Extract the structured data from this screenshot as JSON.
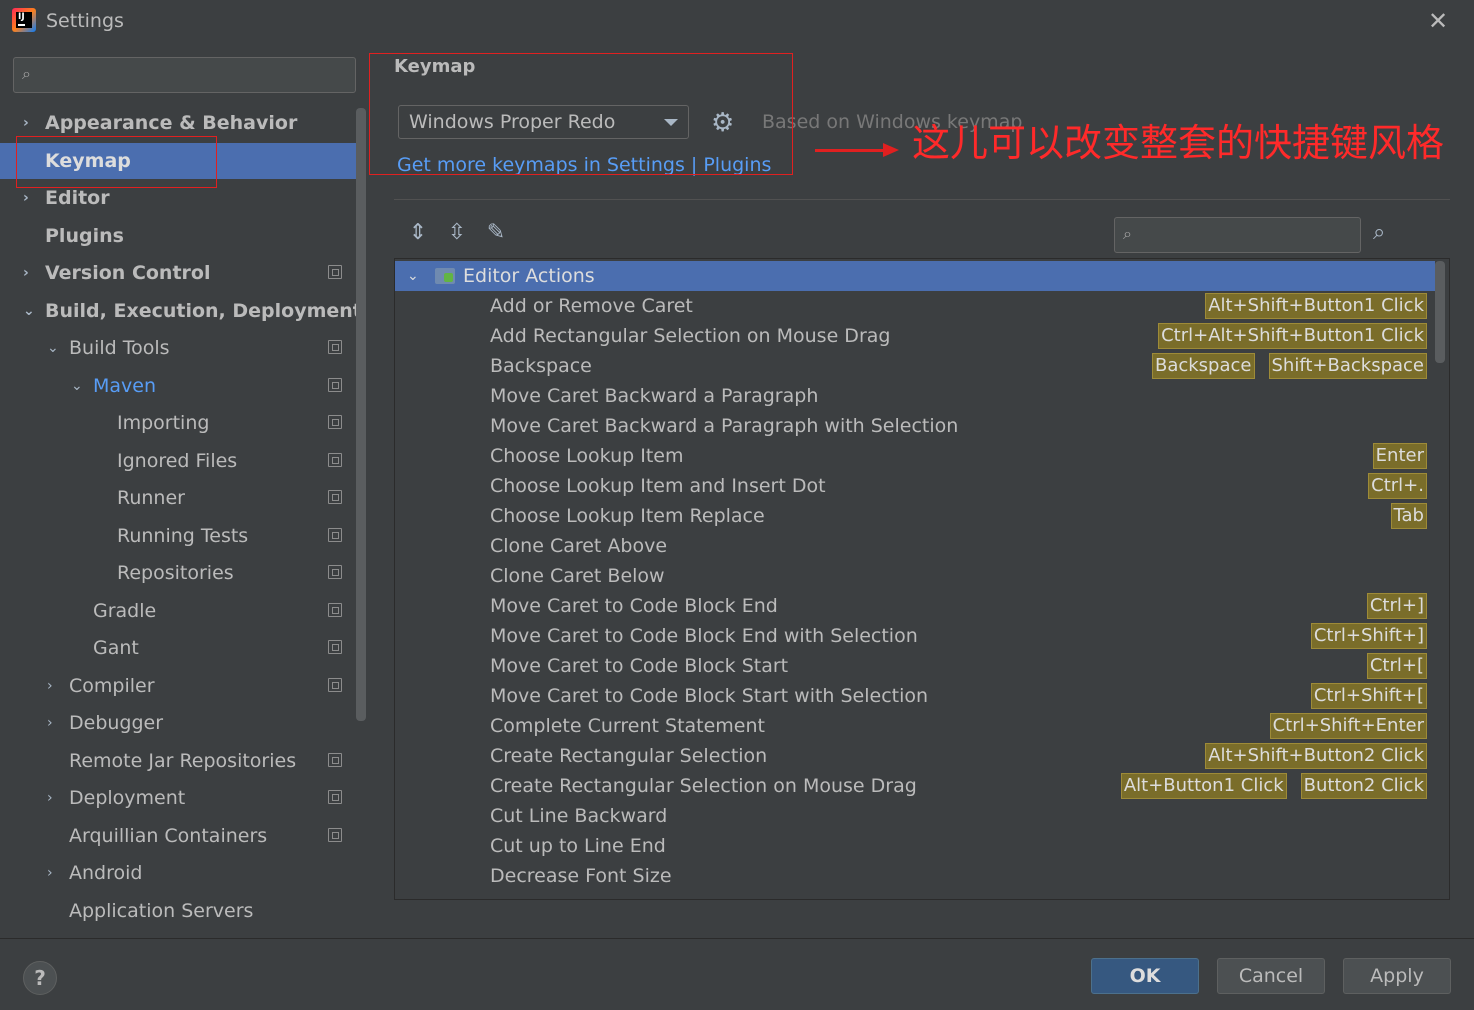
{
  "window": {
    "title": "Settings",
    "app_icon": "intellij-idea-icon",
    "close_glyph": "✕"
  },
  "sidebar": {
    "search_placeholder": "",
    "items": [
      {
        "label": "Appearance & Behavior",
        "arrow": "›"
      },
      {
        "label": "Keymap"
      },
      {
        "label": "Editor",
        "arrow": "›"
      },
      {
        "label": "Plugins"
      },
      {
        "label": "Version Control",
        "arrow": "›"
      },
      {
        "label": "Build, Execution, Deployment",
        "arrow": "⌄"
      },
      {
        "label": "Build Tools",
        "arrow": "⌄"
      },
      {
        "label": "Maven",
        "arrow": "⌄"
      },
      {
        "label": "Importing"
      },
      {
        "label": "Ignored Files"
      },
      {
        "label": "Runner"
      },
      {
        "label": "Running Tests"
      },
      {
        "label": "Repositories"
      },
      {
        "label": "Gradle"
      },
      {
        "label": "Gant"
      },
      {
        "label": "Compiler",
        "arrow": "›"
      },
      {
        "label": "Debugger",
        "arrow": "›"
      },
      {
        "label": "Remote Jar Repositories"
      },
      {
        "label": "Deployment",
        "arrow": "›"
      },
      {
        "label": "Arquillian Containers"
      },
      {
        "label": "Android",
        "arrow": "›"
      },
      {
        "label": "Application Servers"
      }
    ]
  },
  "keymap": {
    "title": "Keymap",
    "selected_keymap": "Windows Proper Redo",
    "based_on": "Based on Windows keymap",
    "get_more_link": "Get more keymaps in Settings | Plugins",
    "filter_placeholder": ""
  },
  "actions": {
    "group": "Editor Actions",
    "rows": [
      {
        "name": "Add or Remove Caret",
        "shortcuts": [
          "Alt+Shift+Button1 Click"
        ]
      },
      {
        "name": "Add Rectangular Selection on Mouse Drag",
        "shortcuts": [
          "Ctrl+Alt+Shift+Button1 Click"
        ]
      },
      {
        "name": "Backspace",
        "shortcuts": [
          "Backspace",
          "Shift+Backspace"
        ]
      },
      {
        "name": "Move Caret Backward a Paragraph",
        "shortcuts": []
      },
      {
        "name": "Move Caret Backward a Paragraph with Selection",
        "shortcuts": []
      },
      {
        "name": "Choose Lookup Item",
        "shortcuts": [
          "Enter"
        ]
      },
      {
        "name": "Choose Lookup Item and Insert Dot",
        "shortcuts": [
          "Ctrl+."
        ]
      },
      {
        "name": "Choose Lookup Item Replace",
        "shortcuts": [
          "Tab"
        ]
      },
      {
        "name": "Clone Caret Above",
        "shortcuts": []
      },
      {
        "name": "Clone Caret Below",
        "shortcuts": []
      },
      {
        "name": "Move Caret to Code Block End",
        "shortcuts": [
          "Ctrl+]"
        ]
      },
      {
        "name": "Move Caret to Code Block End with Selection",
        "shortcuts": [
          "Ctrl+Shift+]"
        ]
      },
      {
        "name": "Move Caret to Code Block Start",
        "shortcuts": [
          "Ctrl+["
        ]
      },
      {
        "name": "Move Caret to Code Block Start with Selection",
        "shortcuts": [
          "Ctrl+Shift+["
        ]
      },
      {
        "name": "Complete Current Statement",
        "shortcuts": [
          "Ctrl+Shift+Enter"
        ]
      },
      {
        "name": "Create Rectangular Selection",
        "shortcuts": [
          "Alt+Shift+Button2 Click"
        ]
      },
      {
        "name": "Create Rectangular Selection on Mouse Drag",
        "shortcuts": [
          "Alt+Button1 Click",
          "Button2 Click"
        ]
      },
      {
        "name": "Cut Line Backward",
        "shortcuts": []
      },
      {
        "name": "Cut up to Line End",
        "shortcuts": []
      },
      {
        "name": "Decrease Font Size",
        "shortcuts": []
      }
    ]
  },
  "annotation": {
    "text": "这儿可以改变整套的快捷键风格",
    "color": "#ff2a2a"
  },
  "buttons": {
    "help": "?",
    "ok": "OK",
    "cancel": "Cancel",
    "apply": "Apply"
  },
  "colors": {
    "background": "#3c3f41",
    "selection": "#4b6eaf",
    "link": "#589df6",
    "shortcut_bg": "#7a6d2a"
  }
}
